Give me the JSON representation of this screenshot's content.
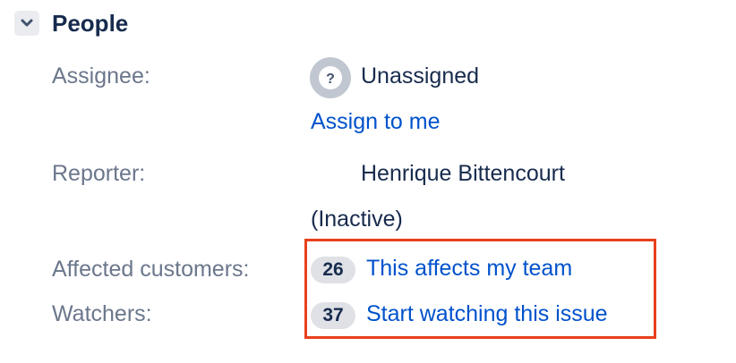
{
  "section": {
    "title": "People",
    "toggle_icon": "chevron-down-icon"
  },
  "fields": {
    "assignee": {
      "label": "Assignee:",
      "value": "Unassigned",
      "assign_link": "Assign to me",
      "avatar_icon": "question-avatar-icon"
    },
    "reporter": {
      "label": "Reporter:",
      "name": "Henrique Bittencourt",
      "status": "(Inactive)"
    },
    "affected_customers": {
      "label": "Affected customers:",
      "count": "26",
      "action": "This affects my team"
    },
    "watchers": {
      "label": "Watchers:",
      "count": "37",
      "action": "Start watching this issue"
    }
  },
  "colors": {
    "link": "#0052cc",
    "label": "#6b778c",
    "text": "#172b4d",
    "highlight": "#e8401c",
    "badge_bg": "#dfe1e6"
  }
}
